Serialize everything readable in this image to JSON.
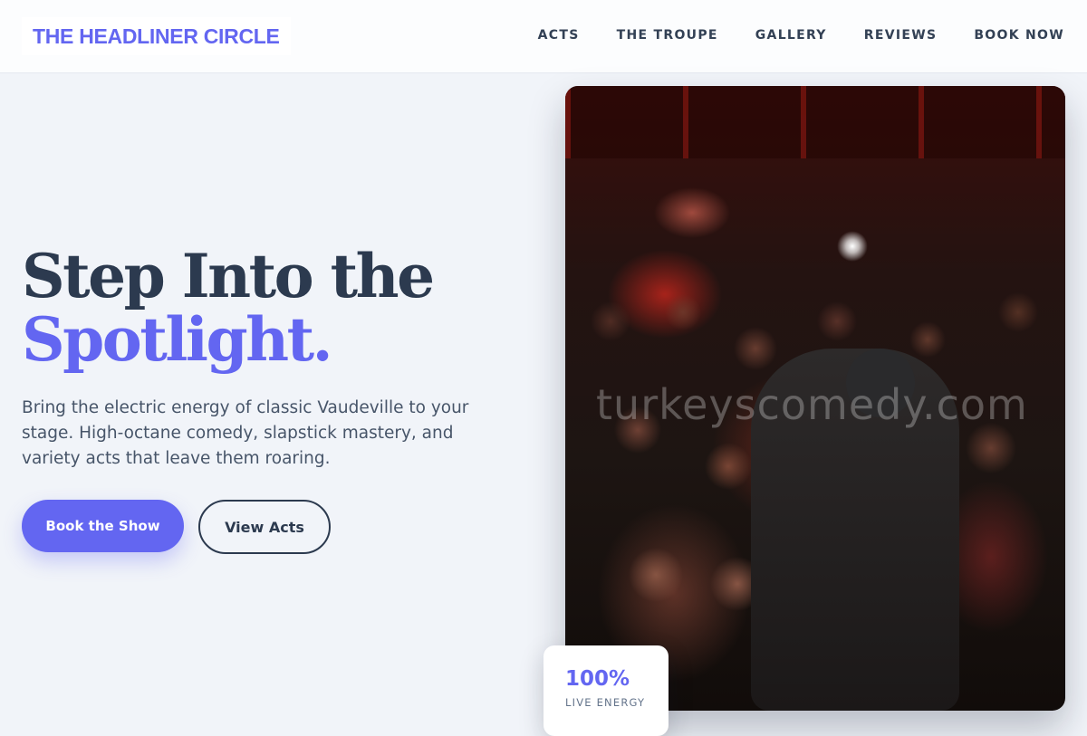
{
  "brand": {
    "name": "THE HEADLINER CIRCLE"
  },
  "nav": {
    "items": [
      {
        "label": "ACTS"
      },
      {
        "label": "THE TROUPE"
      },
      {
        "label": "GALLERY"
      },
      {
        "label": "REVIEWS"
      },
      {
        "label": "BOOK NOW"
      }
    ]
  },
  "hero": {
    "title_line1": "Step Into the",
    "title_line2": "Spotlight.",
    "subtitle": "Bring the electric energy of classic Vaudeville to your stage. High-octane comedy, slapstick mastery, and variety acts that leave them roaring.",
    "primary_cta": "Book the Show",
    "secondary_cta": "View Acts",
    "image_watermark": "turkeyscomedy.com"
  },
  "stat": {
    "value": "100%",
    "label": "LIVE ENERGY"
  },
  "colors": {
    "accent": "#6366f1",
    "heading": "#2c3a4f",
    "background": "#f1f4f9"
  }
}
